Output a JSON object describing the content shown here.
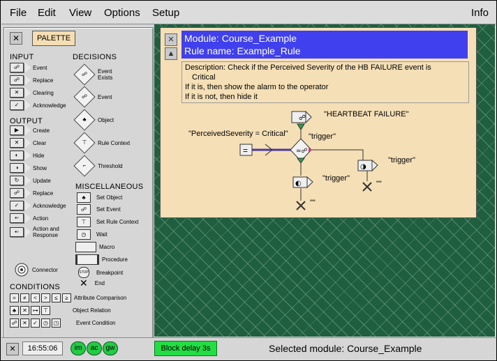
{
  "menubar": {
    "items": [
      "File",
      "Edit",
      "View",
      "Options",
      "Setup"
    ],
    "right": "Info"
  },
  "palette": {
    "title": "PALETTE",
    "sections": {
      "input": "INPUT",
      "decisions": "DECISIONS",
      "output": "OUTPUT",
      "misc": "MISCELLANEOUS",
      "conditions": "CONDITIONS"
    },
    "input_items": [
      "Event",
      "Replace",
      "Clearing",
      "Acknowledge"
    ],
    "output_items": [
      "Create",
      "Clear",
      "Hide",
      "Show",
      "Update",
      "Replace",
      "Acknowledge",
      "Action",
      "Action and Response"
    ],
    "decision_items": [
      "Event Exists",
      "Event",
      "Object",
      "Rule Context",
      "Threshold"
    ],
    "misc_items": [
      "Set Object",
      "Set Event",
      "Set Rule Context",
      "Wait",
      "Macro",
      "Procedure",
      "Breakpoint",
      "End"
    ],
    "connector": "Connector",
    "condition_symbols": [
      "=",
      "≠",
      "<",
      ">",
      "≤",
      "≥"
    ],
    "condition_items": [
      "Attribute Comparison",
      "Object Relation",
      "Event Condition"
    ]
  },
  "rule": {
    "module_line": "Module: Course_Example",
    "rule_line": "Rule name: Example_Rule",
    "description": [
      "Description: Check if the Perceived Severity of the HB FAILURE event is",
      "Critical",
      "If it is, then show the alarm to the operator",
      "If it is not, then hide it"
    ],
    "diagram": {
      "event_label": "\"HEARTBEAT FAILURE\"",
      "condition_label": "\"PerceivedSeverity = Critical\"",
      "trigger_top": "\"trigger\"",
      "trigger_right": "\"trigger\"",
      "trigger_bottom": "\"trigger\"",
      "end_label": "\"\"",
      "end_label_2": "\"\""
    }
  },
  "statusbar": {
    "time": "16:55:06",
    "leds": [
      "im",
      "ac",
      "gw"
    ],
    "block_delay": "Block delay 3s",
    "selected": "Selected module: Course_Example"
  },
  "colors": {
    "rule_header": "#4040ee",
    "rule_bg": "#f5dfb6",
    "workspace": "#1f5f3f",
    "led": "#22cc44"
  }
}
